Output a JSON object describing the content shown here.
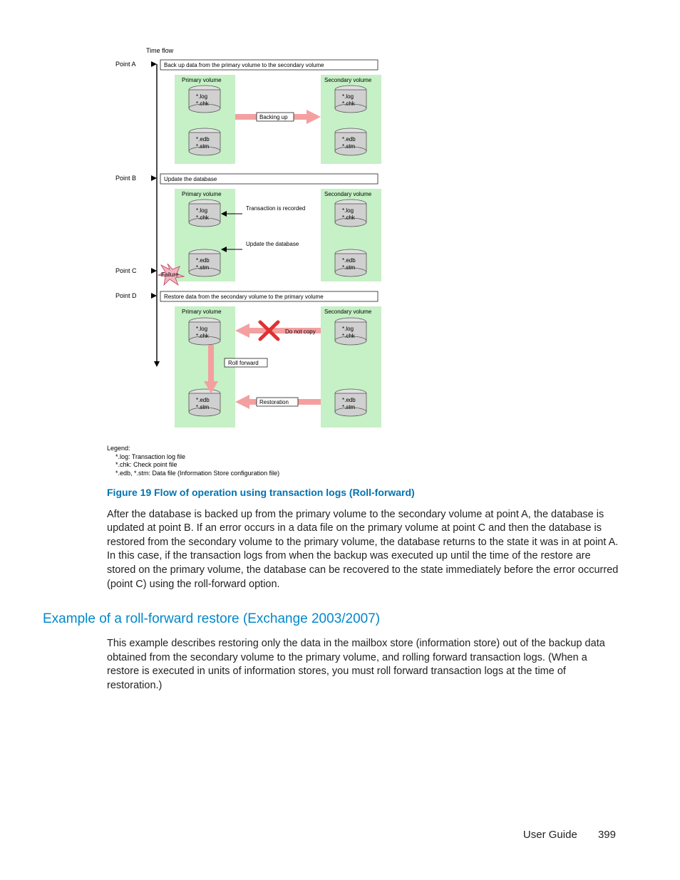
{
  "diagram": {
    "timeflow": "Time flow",
    "points": {
      "a": "Point A",
      "b": "Point B",
      "c": "Point C",
      "d": "Point D"
    },
    "steps": {
      "a": "Back up data from the primary volume to the secondary volume",
      "b": "Update the database",
      "d": "Restore data from the secondary volume to the primary volume"
    },
    "primary": "Primary volume",
    "secondary": "Secondary volume",
    "files": {
      "log": "*.log",
      "chk": "*.chk",
      "edb": "*.edb",
      "stm": "*.stm"
    },
    "labels": {
      "backing": "Backing up",
      "trans_recorded": "Transaction is recorded",
      "update_db": "Update the database",
      "failure": "Failure",
      "notcopy": "Do not copy",
      "rollfwd": "Roll forward",
      "restoration": "Restoration"
    },
    "legend": {
      "title": "Legend:",
      "l1": "*.log: Transaction log file",
      "l2": "*.chk: Check point file",
      "l3": "*.edb, *.stm: Data file (Information Store configuration file)"
    }
  },
  "figure_caption": "Figure 19 Flow of operation using transaction logs (Roll-forward)",
  "para1": "After the database is backed up from the primary volume to the secondary volume at point A, the database is updated at point B. If an error occurs in a data file on the primary volume at point C and then the database is restored from the secondary volume to the primary volume, the database returns to the state it was in at point A. In this case, if the transaction logs from when the backup was executed up until the time of the restore are stored on the primary volume, the database can be recovered to the state immediately before the error occurred (point C) using the roll-forward option.",
  "section_heading": "Example of a roll-forward restore (Exchange 2003/2007)",
  "para2": "This example describes restoring only the data in the mailbox store (information store) out of the backup data obtained from the secondary volume to the primary volume, and rolling forward transaction logs. (When a restore is executed in units of information stores, you must roll forward transaction logs at the time of restoration.)",
  "footer": {
    "doc": "User Guide",
    "page": "399"
  }
}
